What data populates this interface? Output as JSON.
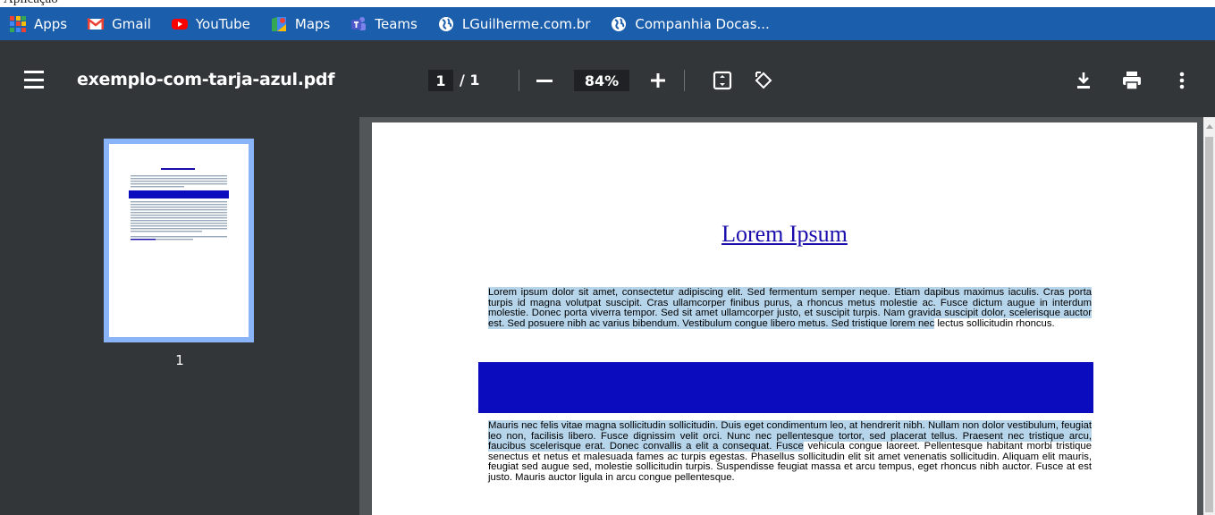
{
  "top_strip": {
    "text": "Aplicação"
  },
  "bookmarks": [
    {
      "label": "Apps",
      "icon": "apps-grid-icon"
    },
    {
      "label": "Gmail",
      "icon": "gmail-icon"
    },
    {
      "label": "YouTube",
      "icon": "youtube-icon"
    },
    {
      "label": "Maps",
      "icon": "maps-icon"
    },
    {
      "label": "Teams",
      "icon": "teams-icon"
    },
    {
      "label": "LGuilherme.com.br",
      "icon": "globe-icon"
    },
    {
      "label": "Companhia Docas...",
      "icon": "globe-icon"
    }
  ],
  "toolbar": {
    "file_name": "exemplo-com-tarja-azul.pdf",
    "current_page": "1",
    "page_separator": "/ 1",
    "zoom": "84%"
  },
  "sidebar": {
    "thumbnail_page_number": "1"
  },
  "document": {
    "title": "Lorem Ipsum",
    "paragraph1_highlighted": "Lorem ipsum dolor sit amet, consectetur adipiscing elit. Sed fermentum semper neque. Etiam dapibus maximus iaculis. Cras porta turpis id magna volutpat suscipit. Cras ullamcorper finibus purus, a rhoncus metus molestie ac. Fusce dictum augue in interdum molestie. Donec porta viverra tempor. Sed sit amet ullamcorper justo, et suscipit turpis. Nam gravida suscipit dolor, scelerisque auctor est. Sed posuere nibh ac varius bibendum. Vestibulum congue libero metus. Sed tristique lorem nec",
    "paragraph1_plain": " lectus sollicitudin rhoncus.",
    "paragraph2_highlighted": "Mauris nec felis vitae magna sollicitudin sollicitudin. Duis eget condimentum leo, at hendrerit nibh. Nullam non dolor vestibulum, feugiat leo non, facilisis libero. Fusce dignissim velit orci. Nunc nec pellentesque tortor, sed placerat tellus. Praesent nec tristique arcu, faucibus scelerisque erat. Donec convallis a elit a consequat. Fusce",
    "paragraph2_plain": " vehicula congue laoreet. Pellentesque habitant morbi tristique senectus et netus et malesuada fames ac turpis egestas. Phasellus sollicitudin elit sit amet venenatis sollicitudin. Aliquam elit mauris, feugiat sed augue sed, molestie sollicitudin turpis. Suspendisse feugiat massa et arcu tempus, eget rhoncus nibh auctor. Fusce at est justo. Mauris auctor ligula in arcu congue pellentesque."
  },
  "colors": {
    "bookmarks_bar": "#1b5eab",
    "toolbar": "#323639",
    "redaction_bar": "#0c0cbf",
    "text_highlight": "#b6d4ea",
    "link_title": "#1a0dab"
  }
}
